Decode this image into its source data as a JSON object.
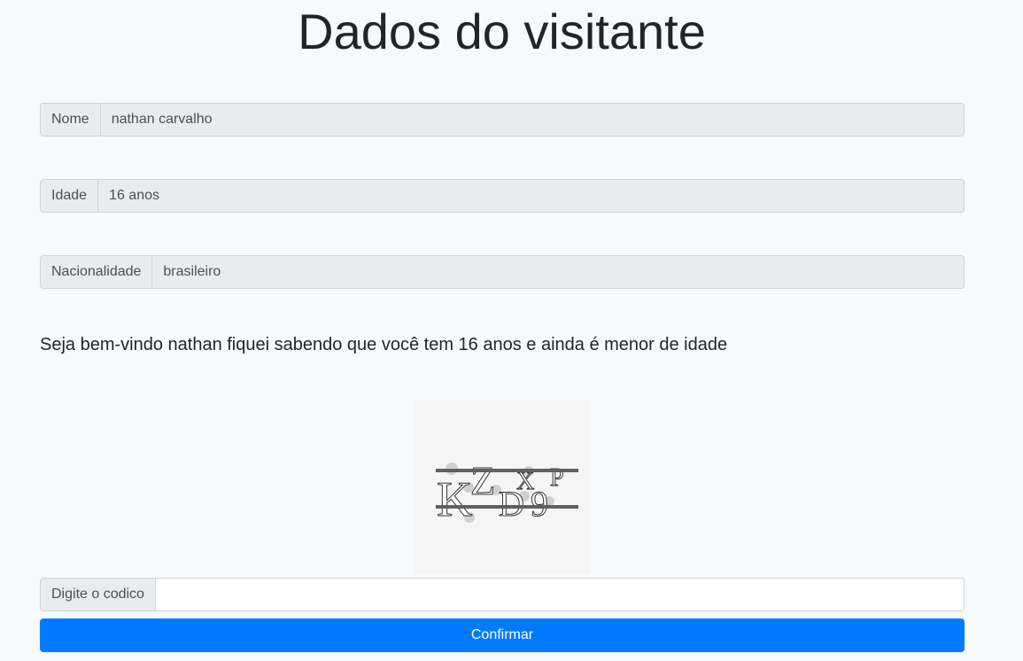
{
  "page": {
    "title": "Dados do visitante"
  },
  "fields": {
    "nome": {
      "label": "Nome",
      "value": "nathan carvalho"
    },
    "idade": {
      "label": "Idade",
      "value": "16 anos"
    },
    "nacionalidade": {
      "label": "Nacionalidade",
      "value": "brasileiro"
    }
  },
  "message": "Seja bem-vindo nathan fiquei sabendo que você tem 16 anos e ainda é menor de idade",
  "captcha": {
    "text": "KZDX9P",
    "code_label": "Digite o codico",
    "code_value": ""
  },
  "actions": {
    "confirm_label": "Confirmar"
  },
  "colors": {
    "background": "#f8f9fa",
    "addon_bg": "#e9ecef",
    "border": "#ced4da",
    "primary": "#007bff"
  }
}
